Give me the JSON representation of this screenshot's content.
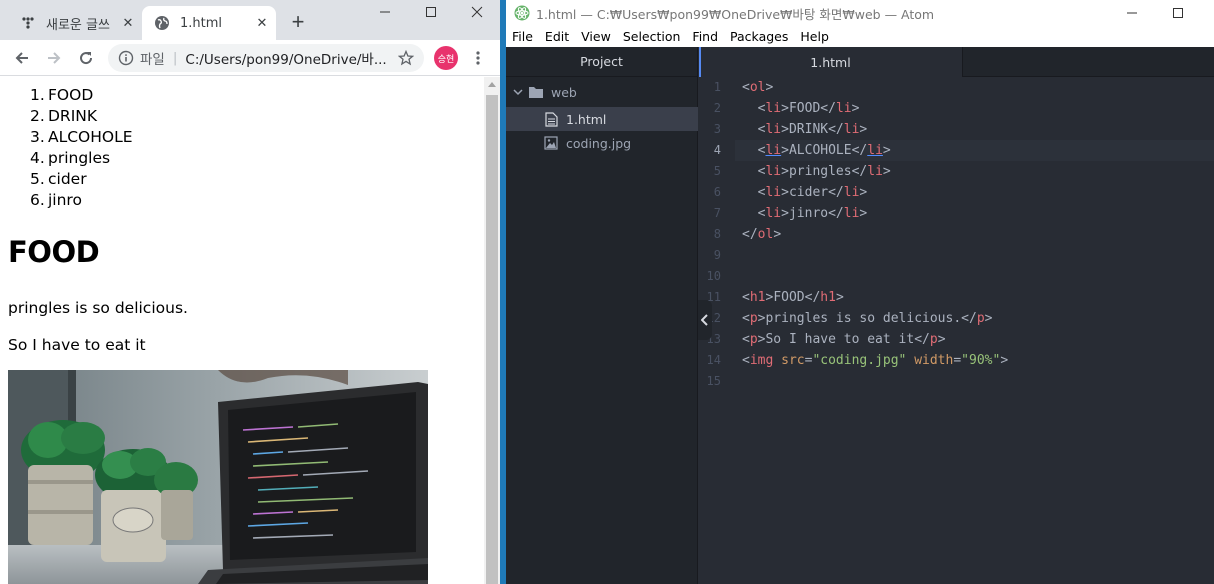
{
  "browser": {
    "tabs": [
      {
        "label": "새로운 글쓰",
        "icon": "dots-icon"
      },
      {
        "label": "1.html",
        "icon": "globe-icon"
      }
    ],
    "address": {
      "scheme": "파일",
      "url": "C:/Users/pon99/OneDrive/바..."
    },
    "profile_initials": "승현",
    "page": {
      "list": [
        {
          "n": "1.",
          "t": "FOOD"
        },
        {
          "n": "2.",
          "t": "DRINK"
        },
        {
          "n": "3.",
          "t": "ALCOHOLE"
        },
        {
          "n": "4.",
          "t": "pringles"
        },
        {
          "n": "5.",
          "t": "cider"
        },
        {
          "n": "6.",
          "t": "jinro"
        }
      ],
      "heading": "FOOD",
      "p1": "pringles is so delicious.",
      "p2": "So I have to eat it"
    }
  },
  "atom": {
    "title": "1.html — C:₩Users₩pon99₩OneDrive₩바탕 화면₩web — Atom",
    "menu": [
      "File",
      "Edit",
      "View",
      "Selection",
      "Find",
      "Packages",
      "Help"
    ],
    "tree": {
      "header": "Project",
      "folder": "web",
      "files": [
        "1.html",
        "coding.jpg"
      ]
    },
    "active_tab": "1.html",
    "line_numbers": [
      "1",
      "2",
      "3",
      "4",
      "5",
      "6",
      "7",
      "8",
      "9",
      "10",
      "11",
      "12",
      "13",
      "14",
      "15"
    ],
    "code": {
      "ol": "ol",
      "li": "li",
      "items": [
        "FOOD",
        "DRINK",
        "ALCOHOLE",
        "pringles",
        "cider",
        "jinro"
      ],
      "h1": "h1",
      "h1_text": "FOOD",
      "p": "p",
      "p1_text": "pringles is so delicious.",
      "p2_text": "So I have to eat it",
      "img": "img",
      "src_attr": "src",
      "src_val": "\"coding.jpg\"",
      "width_attr": "width",
      "width_val": "\"90%\""
    }
  },
  "colors": {
    "tag": "#e06c75",
    "attr": "#d19a66",
    "string": "#98c379",
    "accent": "#1f7ab8"
  }
}
